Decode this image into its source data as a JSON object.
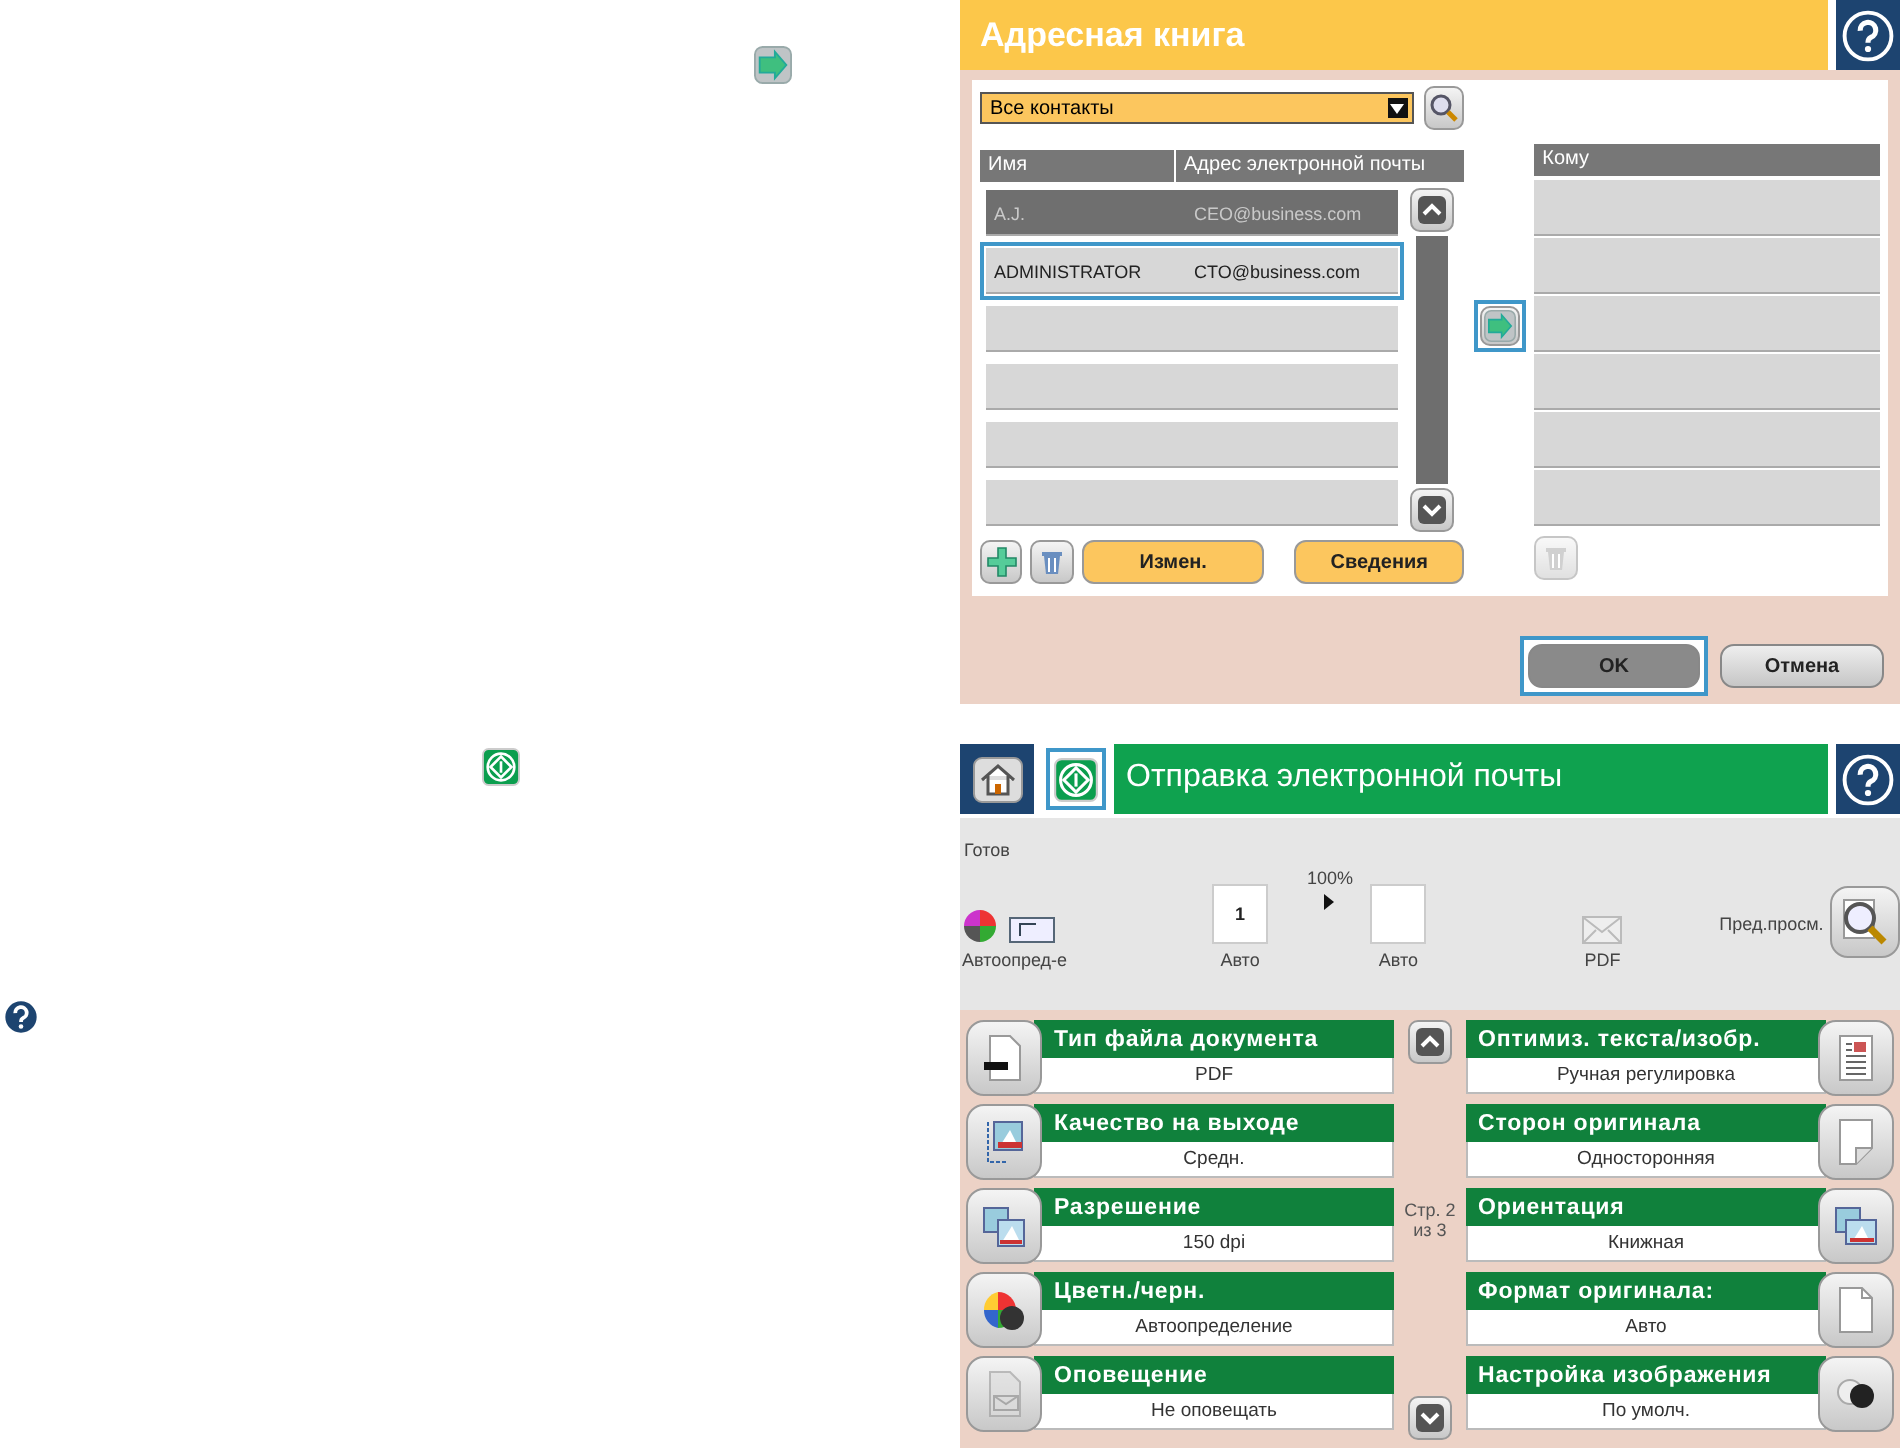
{
  "address_book": {
    "title": "Адресная книга",
    "filter": "Все контакты",
    "columns": [
      "Имя",
      "Адрес электронной почты"
    ],
    "contacts": [
      {
        "name": "A.J.",
        "email": "CEO@business.com",
        "selected": true,
        "highlighted": false
      },
      {
        "name": "ADMINISTRATOR",
        "email": "CTO@business.com",
        "selected": false,
        "highlighted": true
      }
    ],
    "recipients_header": "Кому",
    "add_to_recipients": {
      "highlighted": true
    },
    "buttons": [
      {
        "label": "Измен."
      },
      {
        "label": "Сведения"
      }
    ],
    "dialog_buttons": [
      {
        "label": "OK",
        "highlighted": true
      },
      {
        "label": "Отмена",
        "highlighted": false
      }
    ]
  },
  "email": {
    "title": "Отправка электронной почты",
    "start_highlighted": true,
    "status": "Готов",
    "preview": {
      "color_label": "Автоопред-е",
      "page_number": "1",
      "scale": "100%",
      "source_label": "Авто",
      "output_label": "Авто",
      "format_label": "PDF",
      "preview_label": "Пред.просм."
    },
    "page_indicator": "Стр. 2\nиз 3",
    "left_settings": [
      {
        "title": "Тип файла документа",
        "value": "PDF"
      },
      {
        "title": "Качество на выходе",
        "value": "Средн."
      },
      {
        "title": "Разрешение",
        "value": "150 dpi"
      },
      {
        "title": "Цветн./черн.",
        "value": "Автоопределение"
      },
      {
        "title": "Оповещение",
        "value": "Не оповещать"
      }
    ],
    "right_settings": [
      {
        "title": "Оптимиз. текста/изобр.",
        "value": "Ручная регулировка"
      },
      {
        "title": "Сторон оригинала",
        "value": "Односторонняя"
      },
      {
        "title": "Ориентация",
        "value": "Книжная"
      },
      {
        "title": "Формат оригинала:",
        "value": "Авто"
      },
      {
        "title": "Настройка изображения",
        "value": "По умолч."
      }
    ]
  }
}
